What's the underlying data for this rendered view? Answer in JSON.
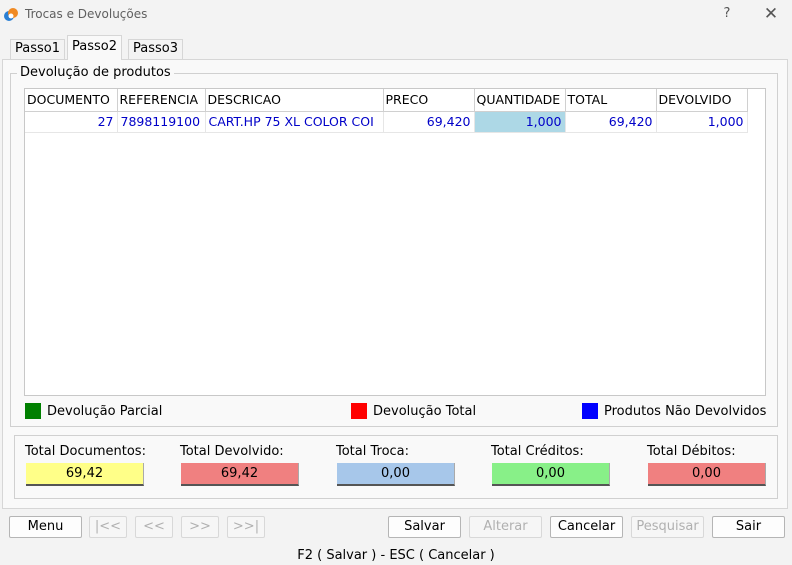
{
  "window": {
    "title": "Trocas e Devoluções",
    "help": "?",
    "close": "✕"
  },
  "tabs": [
    {
      "label": "Passo1"
    },
    {
      "label": "Passo2"
    },
    {
      "label": "Passo3"
    }
  ],
  "group": {
    "title": "Devolução de produtos"
  },
  "grid": {
    "columns": [
      "DOCUMENTO",
      "REFERENCIA",
      "DESCRICAO",
      "PRECO",
      "QUANTIDADE",
      "TOTAL",
      "DEVOLVIDO"
    ],
    "rows": [
      {
        "documento": "27",
        "referencia": "7898119100",
        "descricao": "CART.HP 75 XL COLOR COI",
        "preco": "69,420",
        "quantidade": "1,000",
        "total": "69,420",
        "devolvido": "1,000"
      }
    ]
  },
  "legend": [
    {
      "label": "Devolução Parcial",
      "color": "#008000"
    },
    {
      "label": "Devolução Total",
      "color": "#ff0000"
    },
    {
      "label": "Produtos Não Devolvidos",
      "color": "#0000ff"
    }
  ],
  "totals": [
    {
      "label": "Total Documentos:",
      "value": "69,42",
      "color": "#ffff88"
    },
    {
      "label": "Total Devolvido:",
      "value": "69,42",
      "color": "#f08080"
    },
    {
      "label": "Total Troca:",
      "value": "0,00",
      "color": "#a7c7ea"
    },
    {
      "label": "Total Créditos:",
      "value": "0,00",
      "color": "#88f088"
    },
    {
      "label": "Total Débitos:",
      "value": "0,00",
      "color": "#f08080"
    }
  ],
  "buttons": {
    "menu": "Menu",
    "first": "|<<",
    "prev": "<<",
    "next": ">>",
    "last": ">>|",
    "salvar": "Salvar",
    "alterar": "Alterar",
    "cancelar": "Cancelar",
    "pesquisar": "Pesquisar",
    "sair": "Sair"
  },
  "status": {
    "hint": "F2 ( Salvar )  -  ESC ( Cancelar )"
  }
}
